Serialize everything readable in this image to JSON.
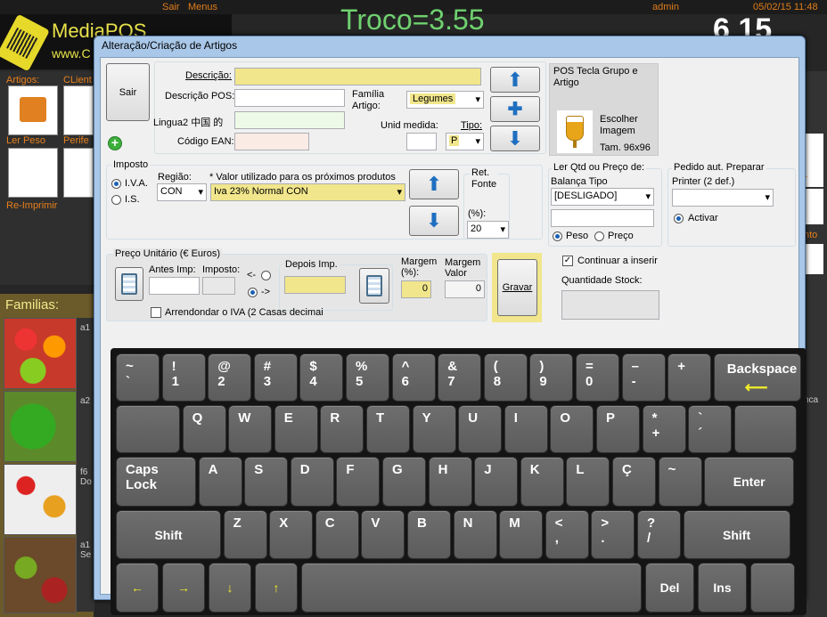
{
  "background": {
    "topbar": {
      "sair": "Sair",
      "menus": "Menus",
      "user": "admin",
      "datetime": "05/02/15 11:48"
    },
    "logo": {
      "name": "MediaPOS",
      "url": "www.C"
    },
    "troco": "Troco=3.55",
    "clock": "6 15",
    "left_labels": {
      "artigos": "Artigos:",
      "clientes": "CLient",
      "ler_peso": "Ler Peso",
      "perifericos": "Perife",
      "reimprimir": "Re-Imprimir"
    },
    "familias_label": "Familias:",
    "list_items": [
      "a1",
      "a2",
      "f6\nDo",
      "a1\nSe"
    ],
    "right_labels": [
      "r",
      "nto",
      "nca"
    ]
  },
  "dialog": {
    "title": "Alteração/Criação de Artigos",
    "sair_label": "Sair",
    "descricao_label": "Descrição:",
    "descricao_value": "",
    "descricao_pos_label": "Descrição POS:",
    "lingua2_label": "Lingua2  中国 的",
    "codigo_ean_label": "Código EAN:",
    "familia_label": "Família\nArtigo:",
    "familia_value": "Legumes",
    "unid_medida_label": "Unid medida:",
    "tipo_label": "Tipo:",
    "tipo_value": "P",
    "pos_tecla": {
      "title": "POS Tecla Grupo e\nArtigo",
      "escolher": "Escolher\nImagem",
      "tam": "Tam. 96x96"
    },
    "imposto": {
      "title": "Imposto",
      "iva_label": "I.V.A.",
      "is_label": "I.S.",
      "regiao_label": "Região:",
      "regiao_value": "CON",
      "note": "* Valor utilizado para os próximos produtos",
      "iva_value": "Iva 23% Normal CON"
    },
    "ret_fonte": {
      "title": "Ret.\nFonte",
      "pct_label": "(%):",
      "value": "20"
    },
    "ler_qtd": {
      "title": "Ler Qtd ou Preço de:",
      "balanca_label": "Balança Tipo",
      "balanca_value": "[DESLIGADO]",
      "peso_label": "Peso",
      "preco_label": "Preço"
    },
    "pedido": {
      "title": "Pedido aut.  Preparar",
      "printer_label": "Printer (2 def.)",
      "activar_label": "Activar"
    },
    "preco": {
      "title": "Preço Unitário  (€ Euros)",
      "antes_label": "Antes Imp:",
      "imposto_label": "Imposto:",
      "arrow_left": "<-",
      "arrow_right": "->",
      "depois_label": "Depois  Imp.",
      "margem_pct_label": "Margem\n(%):",
      "margem_pct_value": "0",
      "margem_valor_label": "Margem\nValor",
      "margem_valor_value": "0",
      "arredondar_label": "Arrendondar o IVA (2 Casas decimai"
    },
    "gravar_label": "Gravar",
    "continuar_label": "Continuar a inserir",
    "quantidade_label": "Quantidade Stock:"
  },
  "keyboard": {
    "row1": [
      "~\n`",
      "!\n1",
      "@\n2",
      "#\n3",
      "$\n4",
      "%\n5",
      "^\n6",
      "&\n7",
      "(\n8",
      ")\n9",
      "=\n0",
      "–\n-",
      "+",
      "Backspace"
    ],
    "row2": [
      "",
      "Q",
      "W",
      "E",
      "R",
      "T",
      "Y",
      "U",
      "I",
      "O",
      "P",
      "*\n+",
      "`\n´",
      ""
    ],
    "row3": [
      "Caps\nLock",
      "A",
      "S",
      "D",
      "F",
      "G",
      "H",
      "J",
      "K",
      "L",
      "Ç",
      "~",
      "Enter"
    ],
    "row4": [
      "Shift",
      "Z",
      "X",
      "C",
      "V",
      "B",
      "N",
      "M",
      "<\n,",
      ">\n.",
      "?\n/",
      "Shift"
    ],
    "row5": [
      "←",
      "→",
      "↓",
      "↑",
      "",
      "Del",
      "Ins",
      ""
    ]
  }
}
